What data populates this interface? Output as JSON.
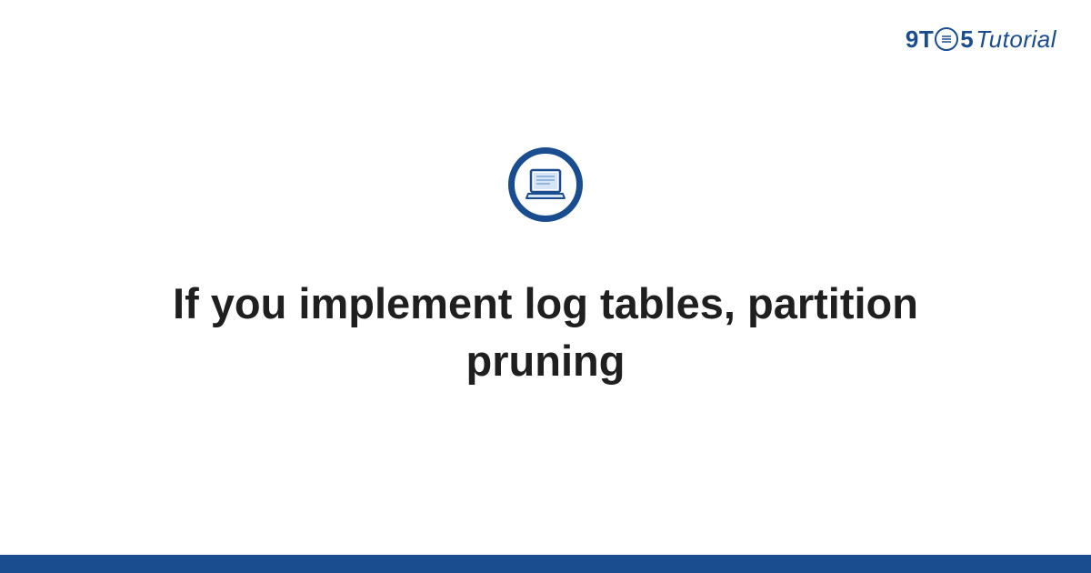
{
  "logo": {
    "prefix": "9T",
    "circle_text": "⊙",
    "suffix_num": "5",
    "suffix_word": "Tutorial"
  },
  "icon": {
    "name": "laptop-icon"
  },
  "title": "If you implement log tables, partition pruning",
  "colors": {
    "brand": "#1a4d8f",
    "accent_light": "#a8c5e8"
  }
}
